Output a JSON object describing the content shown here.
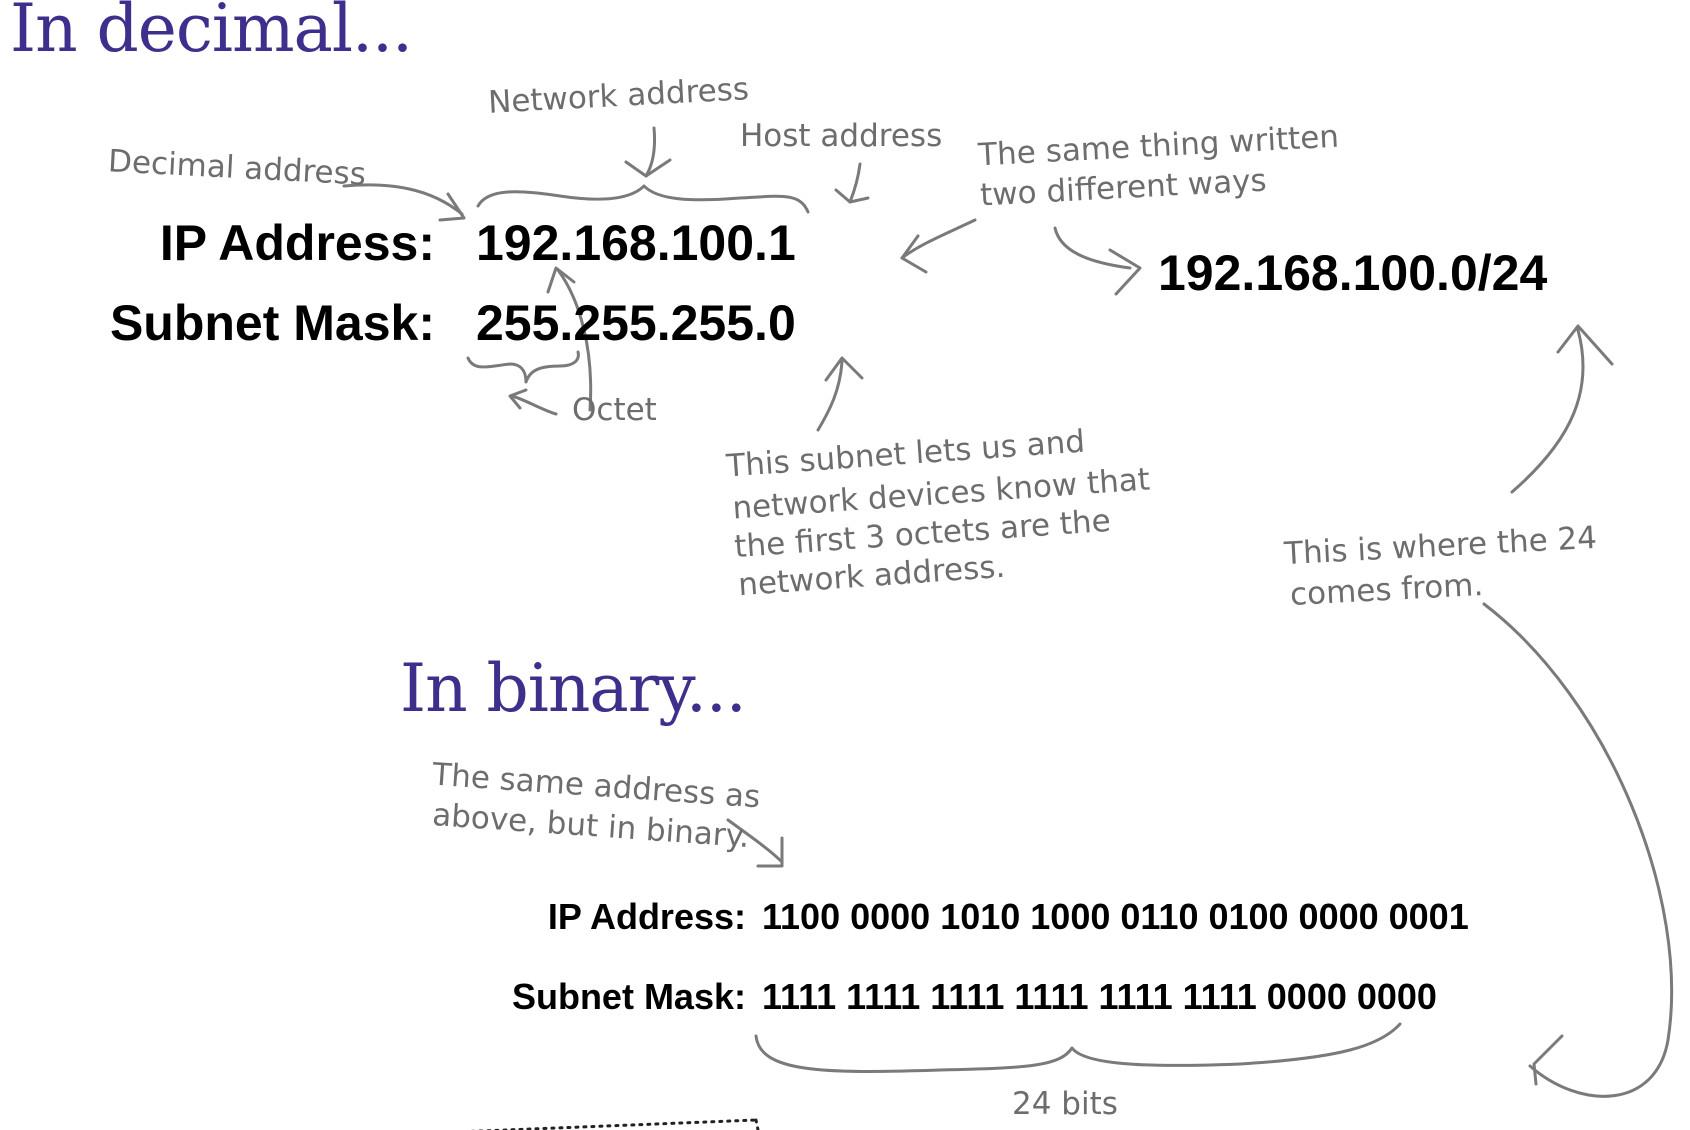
{
  "headings": {
    "decimal": "In decimal...",
    "binary": "In binary..."
  },
  "decimal": {
    "ip_label": "IP Address:",
    "ip_value": "192.168.100.1",
    "mask_label": "Subnet Mask:",
    "mask_value": "255.255.255.0",
    "cidr": "192.168.100.0/24"
  },
  "binary": {
    "ip_label": "IP Address:",
    "ip_value": "1100 0000 1010 1000 0110 0100 0000 0001",
    "mask_label": "Subnet Mask:",
    "mask_value": "1111 1111 1111 1111 1111 1111 0000 0000"
  },
  "annotations": {
    "network_address": "Network address",
    "host_address": "Host address",
    "decimal_address": "Decimal address",
    "same_thing_1": "The same thing written",
    "same_thing_2": "two different ways",
    "octet": "Octet",
    "subnet_note_1": "This subnet lets us and",
    "subnet_note_2": "network devices know that",
    "subnet_note_3": "the first 3 octets are the",
    "subnet_note_4": "network address.",
    "where_24_1": "This is where the 24",
    "where_24_2": "comes from.",
    "binary_note_1": "The same address as",
    "binary_note_2": "above, but in binary.",
    "bits_24": "24 bits"
  }
}
